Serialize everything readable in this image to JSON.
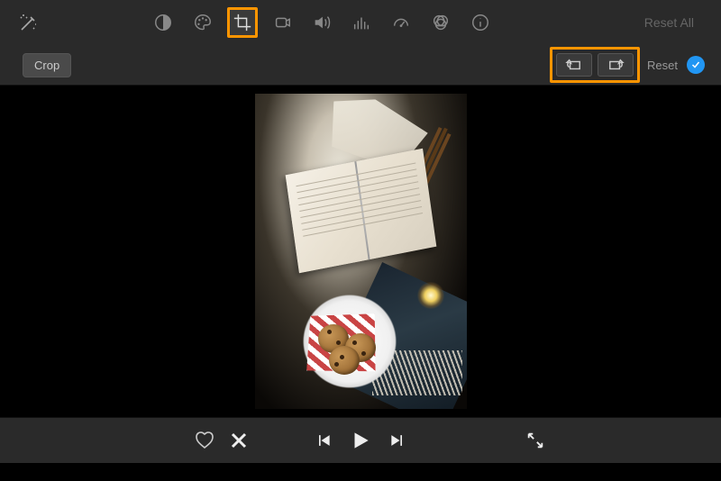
{
  "toolbar": {
    "reset_all_label": "Reset All"
  },
  "subbar": {
    "crop_label": "Crop",
    "reset_label": "Reset"
  },
  "icons": {
    "wand": "wand-icon",
    "color_balance": "color-balance-icon",
    "palette": "palette-icon",
    "crop_tool": "crop-icon",
    "camera": "camera-icon",
    "volume": "volume-icon",
    "equalizer": "equalizer-icon",
    "speed": "speedometer-icon",
    "color_filter": "color-filter-icon",
    "info": "info-icon",
    "rotate_ccw": "rotate-ccw-icon",
    "rotate_cw": "rotate-cw-icon",
    "confirm": "check-icon",
    "favorite": "heart-icon",
    "reject": "x-icon",
    "prev": "prev-icon",
    "play": "play-icon",
    "next": "next-icon",
    "expand": "expand-icon"
  }
}
